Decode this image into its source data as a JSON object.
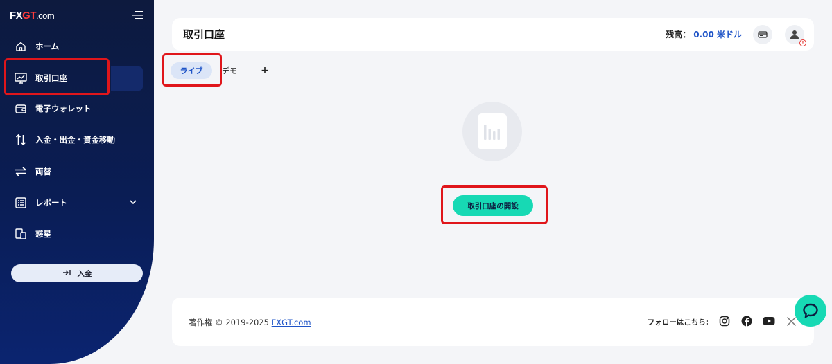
{
  "brand": {
    "logo_main": "FX",
    "logo_accent": "GT",
    "logo_suffix": ".com",
    "accent_color": "#17d9b4",
    "sidebar_color": "#0a1d55",
    "link_color": "#1f54c7"
  },
  "sidebar": {
    "items": [
      {
        "label": "ホーム",
        "icon": "home-icon"
      },
      {
        "label": "取引口座",
        "icon": "chart-monitor-icon",
        "active": true
      },
      {
        "label": "電子ウォレット",
        "icon": "wallet-icon"
      },
      {
        "label": "入金・出金・資金移動",
        "icon": "up-down-arrows-icon"
      },
      {
        "label": "両替",
        "icon": "exchange-icon"
      },
      {
        "label": "レポート",
        "icon": "report-list-icon",
        "has_submenu": true
      },
      {
        "label": "惑星",
        "icon": "devices-icon"
      }
    ],
    "deposit_label": "入金"
  },
  "header": {
    "title": "取引口座",
    "balance_label": "残高：",
    "balance_value": "0.00 米ドル"
  },
  "tabs": [
    {
      "label": "ライブ",
      "active": true
    },
    {
      "label": "デモ",
      "active": false
    },
    {
      "label": "+",
      "active": false
    }
  ],
  "main": {
    "open_account_label": "取引口座の開設"
  },
  "footer": {
    "copyright_prefix": "著作権 © 2019-2025 ",
    "copyright_link": "FXGT.com",
    "follow_label": "フォローはこちら:"
  }
}
